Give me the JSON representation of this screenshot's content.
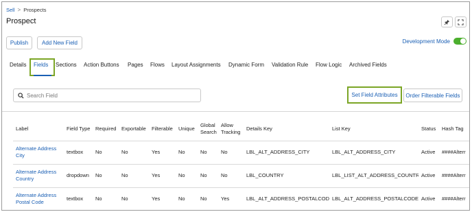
{
  "breadcrumb": {
    "parent": "Sell",
    "separator": ">",
    "current": "Prospects"
  },
  "page": {
    "title": "Prospect"
  },
  "toolbar": {
    "publish": "Publish",
    "add_field": "Add New Field",
    "dev_mode": "Development Mode",
    "dev_mode_on": true
  },
  "colors": {
    "link": "#1a5fb4",
    "highlight": "#7ba525",
    "toggle_on": "#4caf2e"
  },
  "icons": {
    "pin": "pin-icon",
    "expand": "expand-icon",
    "search": "search-icon"
  },
  "tabs": [
    {
      "label": "Details",
      "active": false
    },
    {
      "label": "Fields",
      "active": true
    },
    {
      "label": "Sections",
      "active": false
    },
    {
      "label": "Action Buttons",
      "active": false
    },
    {
      "label": "Pages",
      "active": false
    },
    {
      "label": "Flows",
      "active": false
    },
    {
      "label": "Layout Assignments",
      "active": false
    },
    {
      "label": "Dynamic Form",
      "active": false
    },
    {
      "label": "Validation Rule",
      "active": false
    },
    {
      "label": "Flow Logic",
      "active": false
    },
    {
      "label": "Archived Fields",
      "active": false
    }
  ],
  "search": {
    "placeholder": "Search Field"
  },
  "actions": {
    "set_attrs": "Set Field Attributes",
    "order_filterable": "Order Filterable Fields"
  },
  "table": {
    "headers": {
      "label": "Label",
      "type": "Field Type",
      "required": "Required",
      "exportable": "Exportable",
      "filterable": "Filterable",
      "unique": "Unique",
      "global_a": "Global",
      "global_b": "Search",
      "tracking_a": "Allow",
      "tracking_b": "Tracking",
      "details_key": "Details Key",
      "list_key": "List Key",
      "status": "Status",
      "hash_tag": "Hash Tag"
    },
    "rows": [
      {
        "label_a": "Alternate Address",
        "label_b": "City",
        "type": "textbox",
        "required": "No",
        "exportable": "No",
        "filterable": "Yes",
        "unique": "No",
        "global": "No",
        "tracking": "No",
        "details_key": "LBL_ALT_ADDRESS_CITY",
        "list_key": "LBL_ALT_ADDRESS_CITY",
        "status": "Active",
        "hash_tag": "####Alterr"
      },
      {
        "label_a": "Alternate Address",
        "label_b": "Country",
        "type": "dropdown",
        "required": "No",
        "exportable": "No",
        "filterable": "Yes",
        "unique": "No",
        "global": "No",
        "tracking": "No",
        "details_key": "LBL_COUNTRY",
        "list_key": "LBL_LIST_ALT_ADDRESS_COUNTRY",
        "status": "Active",
        "hash_tag": "####Alterr"
      },
      {
        "label_a": "Alternate Address",
        "label_b": "Postal Code",
        "type": "textbox",
        "required": "No",
        "exportable": "No",
        "filterable": "Yes",
        "unique": "No",
        "global": "No",
        "tracking": "Yes",
        "details_key": "LBL_ALT_ADDRESS_POSTALCODE",
        "list_key": "LBL_ALT_ADDRESS_POSTALCODE",
        "status": "Active",
        "hash_tag": "####Alterr"
      }
    ]
  }
}
